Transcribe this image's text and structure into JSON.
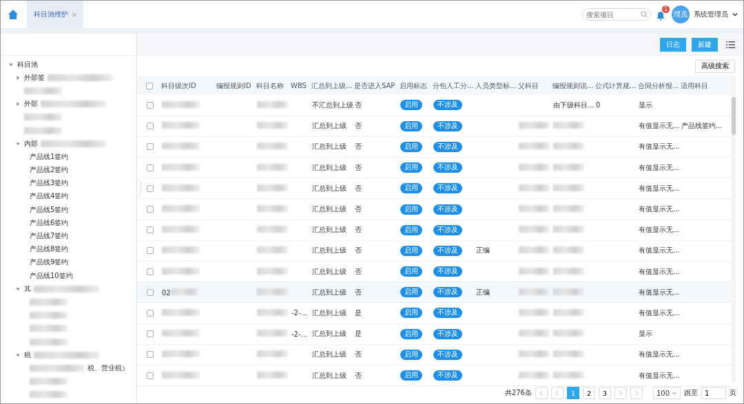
{
  "header": {
    "tabs": [
      {
        "label": "科目池维护",
        "selected": true,
        "closable": true
      }
    ],
    "search": {
      "placeholder": "搜索项目"
    },
    "notifications": {
      "count": "1"
    },
    "user": {
      "avatar_text": "理员",
      "name": "系统管理员"
    }
  },
  "tree": {
    "items": [
      {
        "label": "科目池",
        "expanded": true,
        "children": [
          {
            "label": "外部签",
            "blurred": true,
            "expanded": false
          },
          {
            "blurred": true
          },
          {
            "label": "外部",
            "blurred": true,
            "expanded": false
          },
          {
            "blurred": true
          },
          {
            "blurred": true
          },
          {
            "label": "内部",
            "blurred": true,
            "expanded": true,
            "children": [
              {
                "label": "产品线1签约"
              },
              {
                "label": "产品线2签约"
              },
              {
                "label": "产品线3签约"
              },
              {
                "label": "产品线4签约"
              },
              {
                "label": "产品线5签约"
              },
              {
                "label": "产品线6签约"
              },
              {
                "label": "产品线7签约"
              },
              {
                "label": "产品线8签约"
              },
              {
                "label": "产品线9签约"
              },
              {
                "label": "产品线10签约"
              }
            ]
          },
          {
            "label": "其",
            "blurred": true,
            "expanded": true,
            "children": [
              {
                "blurred": true
              },
              {
                "blurred": true
              },
              {
                "blurred": true
              },
              {
                "blurred": true
              }
            ]
          },
          {
            "label": "税",
            "blurred": true,
            "expanded": true,
            "children": [
              {
                "label": "税、营业税）",
                "blurred_prefix": true
              },
              {
                "blurred": true
              },
              {
                "blurred": true
              }
            ]
          }
        ]
      }
    ]
  },
  "toolbar": {
    "buttons": [
      "日志",
      "新建"
    ],
    "advanced_search": "高级搜索"
  },
  "table": {
    "select_all": {
      "checked": false
    },
    "columns": [
      {
        "label": "科目级次ID"
      },
      {
        "label": "编报规则ID"
      },
      {
        "label": "科目名称"
      },
      {
        "label": "WBS"
      },
      {
        "label": "汇总到上级..."
      },
      {
        "label": "是否进入SAP"
      },
      {
        "label": "启用标志",
        "kind": "tag"
      },
      {
        "label": "分包人工分...",
        "kind": "tag"
      },
      {
        "label": "人员类型标..."
      },
      {
        "label": "父科目"
      },
      {
        "label": "编报规则说..."
      },
      {
        "label": "公式计算规..."
      },
      {
        "label": "合同分析报..."
      },
      {
        "label": "适用科目"
      }
    ],
    "rows": [
      {
        "checked": false,
        "highlighted": false,
        "cells": [
          {
            "blurred": true
          },
          null,
          {
            "blurred": true
          },
          null,
          {
            "text": "不汇总到上级"
          },
          {
            "text": "否"
          },
          {
            "text": "启用"
          },
          {
            "text": "不涉及"
          },
          null,
          null,
          {
            "text": "由下级科目..."
          },
          {
            "text": "0"
          },
          {
            "text": "显示"
          },
          null
        ]
      },
      {
        "checked": false,
        "highlighted": false,
        "cells": [
          {
            "blurred": true
          },
          null,
          {
            "blurred": true
          },
          null,
          {
            "text": "汇总到上级"
          },
          {
            "text": "否"
          },
          {
            "text": "启用"
          },
          {
            "text": "不涉及"
          },
          null,
          {
            "blurred": true
          },
          {
            "blurred": true
          },
          null,
          {
            "text": "有值显示无..."
          },
          {
            "text": "产品线签约..."
          }
        ]
      },
      {
        "checked": false,
        "highlighted": false,
        "cells": [
          {
            "blurred": true
          },
          null,
          {
            "blurred": true
          },
          null,
          {
            "text": "汇总到上级"
          },
          {
            "text": "否"
          },
          {
            "text": "启用"
          },
          {
            "text": "不涉及"
          },
          null,
          {
            "blurred": true
          },
          {
            "blurred": true
          },
          null,
          {
            "text": "有值显示无..."
          },
          null
        ]
      },
      {
        "checked": false,
        "highlighted": false,
        "cells": [
          {
            "blurred": true
          },
          null,
          {
            "blurred": true
          },
          null,
          {
            "text": "汇总到上级"
          },
          {
            "text": "否"
          },
          {
            "text": "启用"
          },
          {
            "text": "不涉及"
          },
          null,
          {
            "blurred": true
          },
          {
            "blurred": true
          },
          null,
          {
            "text": "有值显示无..."
          },
          null
        ]
      },
      {
        "checked": false,
        "highlighted": false,
        "cells": [
          {
            "blurred": true
          },
          null,
          {
            "blurred": true
          },
          null,
          {
            "text": "汇总到上级"
          },
          {
            "text": "否"
          },
          {
            "text": "启用"
          },
          {
            "text": "不涉及"
          },
          null,
          {
            "blurred": true
          },
          {
            "blurred": true
          },
          null,
          {
            "text": "有值显示无..."
          },
          null
        ]
      },
      {
        "checked": false,
        "highlighted": false,
        "cells": [
          {
            "blurred": true
          },
          null,
          {
            "blurred": true
          },
          null,
          {
            "text": "汇总到上级"
          },
          {
            "text": "否"
          },
          {
            "text": "启用"
          },
          {
            "text": "不涉及"
          },
          null,
          {
            "blurred": true
          },
          {
            "blurred": true
          },
          null,
          {
            "text": "有值显示无..."
          },
          null
        ]
      },
      {
        "checked": false,
        "highlighted": false,
        "cells": [
          {
            "blurred": true
          },
          null,
          {
            "blurred": true
          },
          null,
          {
            "text": "汇总到上级"
          },
          {
            "text": "否"
          },
          {
            "text": "启用"
          },
          {
            "text": "不涉及"
          },
          null,
          {
            "blurred": true
          },
          {
            "blurred": true
          },
          null,
          {
            "text": "有值显示无..."
          },
          null
        ]
      },
      {
        "checked": false,
        "highlighted": false,
        "cells": [
          {
            "blurred": true
          },
          null,
          {
            "blurred": true
          },
          null,
          {
            "text": "汇总到上级"
          },
          {
            "text": "否"
          },
          {
            "text": "启用"
          },
          {
            "text": "不涉及"
          },
          {
            "text": "正编"
          },
          {
            "blurred": true
          },
          {
            "blurred": true
          },
          null,
          {
            "text": "有值显示无..."
          },
          null
        ]
      },
      {
        "checked": false,
        "highlighted": false,
        "cells": [
          {
            "blurred": true
          },
          null,
          {
            "blurred": true
          },
          null,
          {
            "text": "汇总到上级"
          },
          {
            "text": "否"
          },
          {
            "text": "启用"
          },
          {
            "text": "不涉及"
          },
          null,
          {
            "blurred": true
          },
          {
            "blurred": true
          },
          null,
          {
            "text": "有值显示无..."
          },
          null
        ]
      },
      {
        "checked": false,
        "highlighted": true,
        "cells": [
          {
            "text": "02",
            "blurred": true
          },
          null,
          {
            "blurred": true
          },
          null,
          {
            "text": "汇总到上级"
          },
          {
            "text": "否"
          },
          {
            "text": "启用"
          },
          {
            "text": "不涉及"
          },
          {
            "text": "正编"
          },
          {
            "blurred": true
          },
          {
            "blurred": true
          },
          null,
          {
            "text": "有值显示无..."
          },
          null
        ]
      },
      {
        "checked": false,
        "highlighted": false,
        "cells": [
          {
            "blurred": true
          },
          null,
          {
            "blurred": true
          },
          {
            "text": "-2-..."
          },
          {
            "text": "汇总到上级"
          },
          {
            "text": "是"
          },
          {
            "text": "启用"
          },
          {
            "text": "不涉及"
          },
          null,
          {
            "blurred": true
          },
          {
            "blurred": true
          },
          null,
          {
            "text": "有值显示无..."
          },
          null
        ]
      },
      {
        "checked": false,
        "highlighted": false,
        "cells": [
          {
            "blurred": true
          },
          null,
          {
            "blurred": true
          },
          {
            "text": "-2-..."
          },
          {
            "text": "汇总到上级"
          },
          {
            "text": "是"
          },
          {
            "text": "启用"
          },
          {
            "text": "不涉及"
          },
          null,
          {
            "blurred": true
          },
          {
            "blurred": true
          },
          null,
          {
            "text": "显示"
          },
          null
        ]
      },
      {
        "checked": false,
        "highlighted": false,
        "cells": [
          {
            "blurred": true
          },
          null,
          {
            "blurred": true
          },
          null,
          {
            "text": "汇总到上级"
          },
          {
            "text": "否"
          },
          {
            "text": "启用"
          },
          {
            "text": "不涉及"
          },
          null,
          {
            "blurred": true
          },
          {
            "blurred": true
          },
          null,
          {
            "text": "有值显示无..."
          },
          null
        ]
      },
      {
        "checked": false,
        "highlighted": false,
        "cells": [
          {
            "blurred": true
          },
          null,
          {
            "blurred": true
          },
          null,
          {
            "text": "汇总到上级"
          },
          {
            "text": "否"
          },
          {
            "text": "启用"
          },
          {
            "text": "不涉及"
          },
          null,
          {
            "blurred": true
          },
          {
            "blurred": true
          },
          null,
          {
            "text": "有值显示无..."
          },
          null
        ]
      }
    ]
  },
  "pagination": {
    "total": "共276条",
    "pages": [
      {
        "label": "1",
        "selected": true
      },
      {
        "label": "2",
        "selected": false
      },
      {
        "label": "3",
        "selected": false
      }
    ],
    "page_size": "100",
    "jump_label": "跳至",
    "jump_value": "1",
    "page_unit": "页"
  }
}
